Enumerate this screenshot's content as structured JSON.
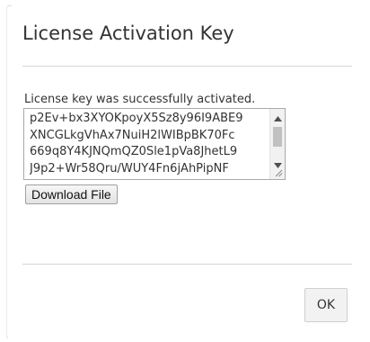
{
  "dialog": {
    "title": "License Activation Key",
    "status_message": "License key was successfully activated.",
    "license_key_lines": [
      "p2Ev+bx3XYOKpoyX5Sz8y96I9ABE9",
      "XNCGLkgVhAx7NuiH2lWIBpBK70Fc",
      "669q8Y4KJNQmQZ0Sle1pVa8JhetL9",
      "J9p2+Wr58Qru/WUY4Fn6jAhPipNF"
    ],
    "download_button_label": "Download File",
    "ok_button_label": "OK"
  },
  "colors": {
    "title_text": "#333333",
    "divider": "#d6d6d6",
    "button_face": "#f2f2f2"
  },
  "icons": {
    "scroll_up": "triangle-up-icon",
    "scroll_down": "triangle-down-icon",
    "resize": "resize-grip-icon"
  }
}
